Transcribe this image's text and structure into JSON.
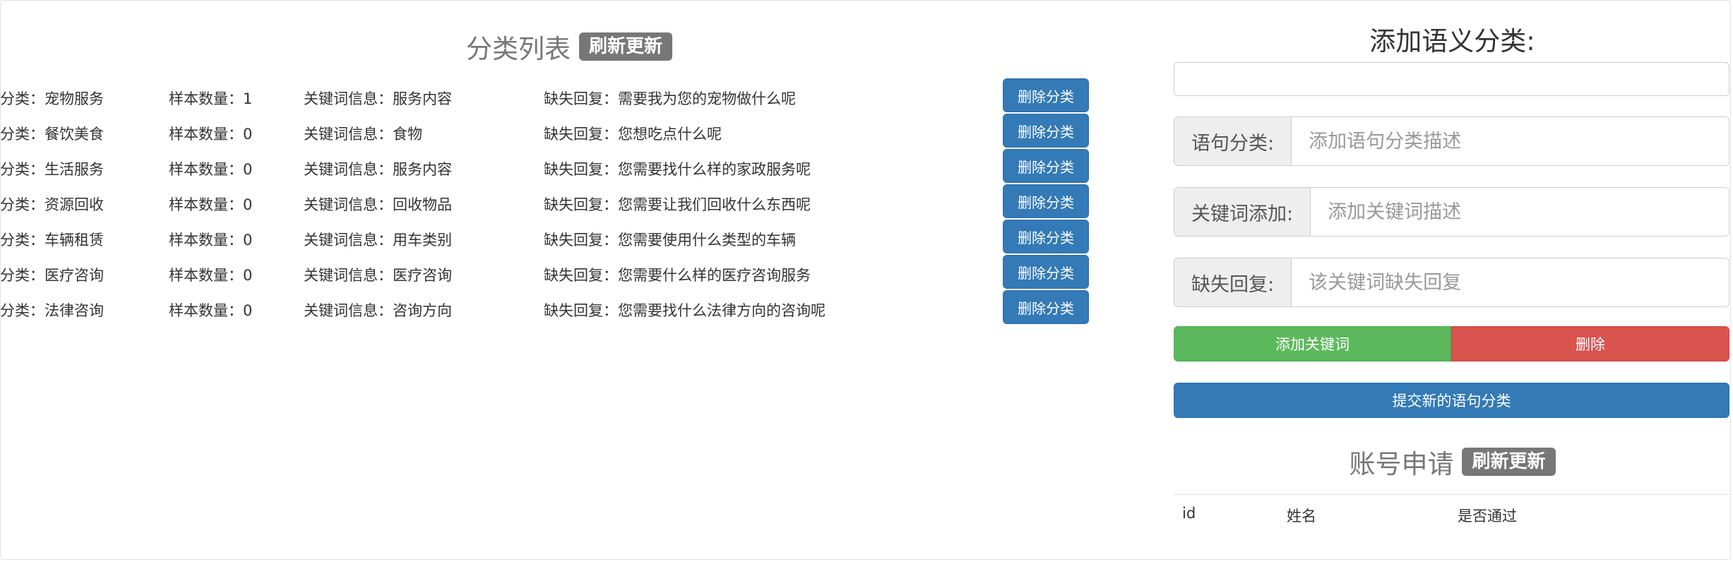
{
  "category_list": {
    "title": "分类列表",
    "refresh_label": "刷新更新",
    "delete_label": "删除分类",
    "rows": [
      {
        "category": "分类：宠物服务",
        "count": "样本数量：1",
        "keyword": "关键词信息：服务内容",
        "missing": "缺失回复：需要我为您的宠物做什么呢"
      },
      {
        "category": "分类：餐饮美食",
        "count": "样本数量：0",
        "keyword": "关键词信息：食物",
        "missing": "缺失回复：您想吃点什么呢"
      },
      {
        "category": "分类：生活服务",
        "count": "样本数量：0",
        "keyword": "关键词信息：服务内容",
        "missing": "缺失回复：您需要找什么样的家政服务呢"
      },
      {
        "category": "分类：资源回收",
        "count": "样本数量：0",
        "keyword": "关键词信息：回收物品",
        "missing": "缺失回复：您需要让我们回收什么东西呢"
      },
      {
        "category": "分类：车辆租赁",
        "count": "样本数量：0",
        "keyword": "关键词信息：用车类别",
        "missing": "缺失回复：您需要使用什么类型的车辆"
      },
      {
        "category": "分类：医疗咨询",
        "count": "样本数量：0",
        "keyword": "关键词信息：医疗咨询",
        "missing": "缺失回复：您需要什么样的医疗咨询服务"
      },
      {
        "category": "分类：法律咨询",
        "count": "样本数量：0",
        "keyword": "关键词信息：咨询方向",
        "missing": "缺失回复：您需要找什么法律方向的咨询呢"
      }
    ]
  },
  "add_form": {
    "title": "添加语义分类:",
    "sentence_label": "语句分类:",
    "sentence_placeholder": "添加语句分类描述",
    "keyword_label": "关键词添加:",
    "keyword_placeholder": "添加关键词描述",
    "missing_label": "缺失回复:",
    "missing_placeholder": "该关键词缺失回复",
    "add_keyword_label": "添加关键词",
    "delete_label": "删除",
    "submit_label": "提交新的语句分类"
  },
  "account": {
    "title": "账号申请",
    "refresh_label": "刷新更新",
    "columns": [
      "id",
      "姓名",
      "是否通过"
    ]
  },
  "colors": {
    "primary": "#337ab7",
    "success": "#5cb85c",
    "danger": "#d9534f",
    "badge": "#777777"
  }
}
